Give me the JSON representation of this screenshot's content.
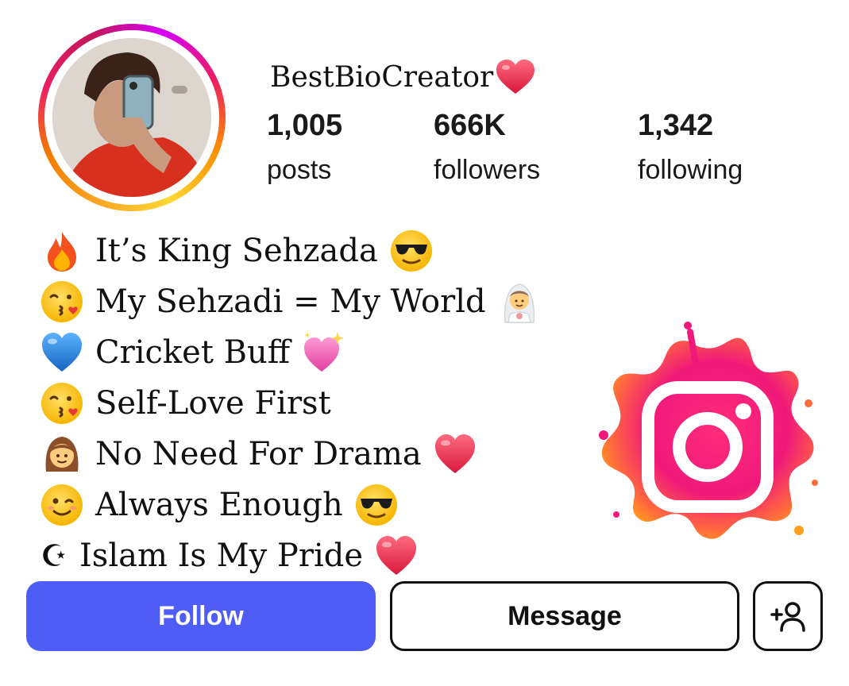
{
  "profile": {
    "username": "BestBioCreator",
    "stats": [
      {
        "value": "1,005",
        "label": "posts"
      },
      {
        "value": "666K",
        "label": "followers"
      },
      {
        "value": "1,342",
        "label": "following"
      }
    ]
  },
  "bio": [
    {
      "lead": "fire-emoji",
      "text": "It’s King Sehzada",
      "trail": "sunglasses-emoji"
    },
    {
      "lead": "kiss-emoji",
      "text": "My Sehzadi = My World",
      "trail": "bride-emoji"
    },
    {
      "lead": "blue-heart-emoji",
      "text": "Cricket Buff",
      "trail": "sparkling-heart-emoji"
    },
    {
      "lead": "kiss-emoji",
      "text": "Self-Love First",
      "trail": ""
    },
    {
      "lead": "girl-emoji",
      "text": "No Need For Drama",
      "trail": "red-heart-emoji"
    },
    {
      "lead": "wink-emoji",
      "text": "Always Enough",
      "trail": "sunglasses-emoji"
    },
    {
      "lead": "crescent-star",
      "lead_glyph": "☪",
      "text": "Islam Is My Pride",
      "trail": "red-heart-emoji"
    }
  ],
  "buttons": {
    "follow": "Follow",
    "message": "Message",
    "add_user_icon": "person-add-icon"
  },
  "colors": {
    "follow_bg": "#4e5df5",
    "ring_gradient": [
      "#f9a825",
      "#e91e63",
      "#d500f9"
    ],
    "logo_gradient": [
      "#ff4d8d",
      "#e91e63",
      "#ff9f1c"
    ]
  }
}
